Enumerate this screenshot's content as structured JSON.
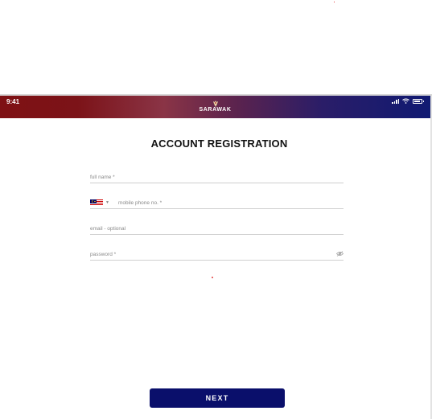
{
  "status_bar": {
    "time": "9:41"
  },
  "header": {
    "brand_prefix": "",
    "brand_name": "SARAWAK"
  },
  "title": "ACCOUNT REGISTRATION",
  "form": {
    "full_name": {
      "placeholder": "full name *",
      "value": ""
    },
    "phone": {
      "country": "Malaysia",
      "placeholder": "mobile phone no. *",
      "value": ""
    },
    "email": {
      "placeholder": "email - optional",
      "value": ""
    },
    "password": {
      "placeholder": "password *",
      "value": ""
    }
  },
  "next_button": {
    "label": "NEXT"
  },
  "colors": {
    "header_start": "#7e1114",
    "header_end": "#101a72",
    "primary_button": "#0a0f6b",
    "accent_red": "#b3101b"
  },
  "icons": {
    "signal": "signal-icon",
    "wifi": "wifi-icon",
    "battery": "battery-icon",
    "emblem": "hornbill-emblem-icon",
    "flag": "malaysia-flag-icon",
    "chevron": "chevron-down-icon",
    "eye": "eye-off-icon"
  }
}
